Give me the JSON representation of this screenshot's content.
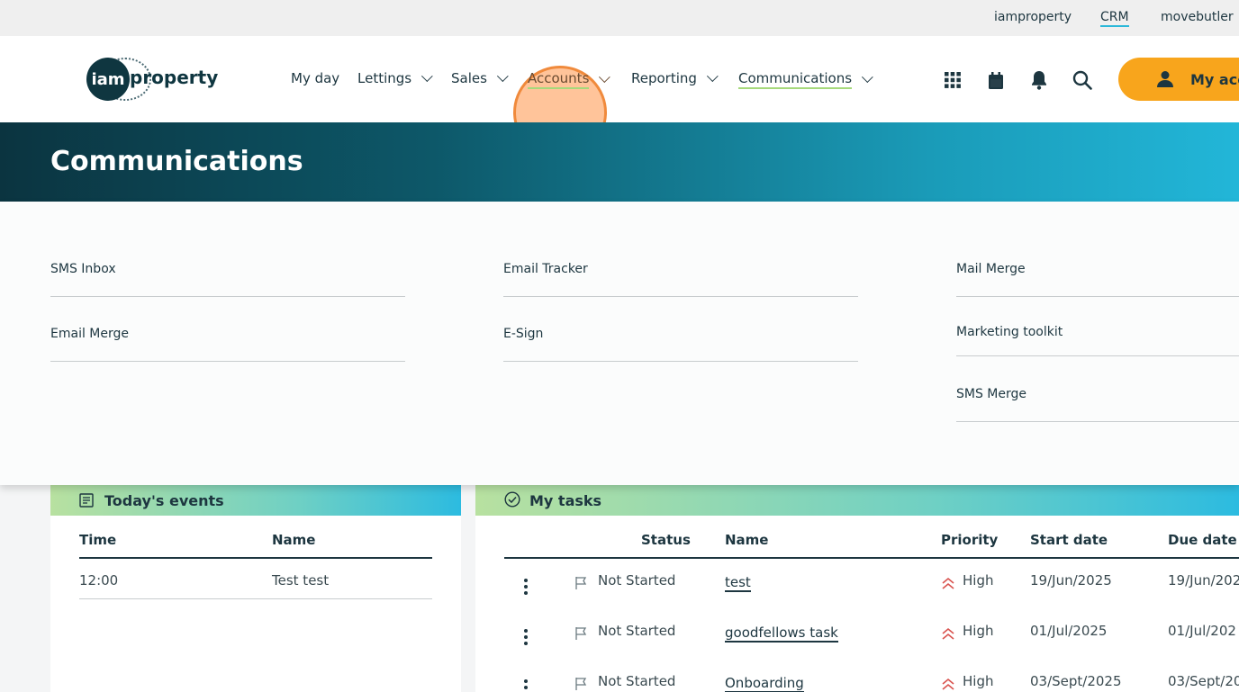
{
  "utility_bar": {
    "links": [
      "iamproperty",
      "CRM",
      "movebutler"
    ]
  },
  "logo": {
    "mark": "iam",
    "word": "property"
  },
  "nav": {
    "items": [
      {
        "label": "My day"
      },
      {
        "label": "Lettings"
      },
      {
        "label": "Sales"
      },
      {
        "label": "Accounts"
      },
      {
        "label": "Reporting"
      },
      {
        "label": "Communications"
      }
    ]
  },
  "header_icons": [
    "apps-grid-icon",
    "calendar-icon",
    "bell-icon",
    "search-icon"
  ],
  "account": {
    "label": "My acc"
  },
  "banner": {
    "title": "Communications"
  },
  "dropdown": {
    "columns": [
      [
        "SMS Inbox",
        "Email Merge"
      ],
      [
        "Email Tracker",
        "E-Sign"
      ],
      [
        "Mail Merge",
        "Marketing toolkit",
        "SMS Merge"
      ]
    ]
  },
  "events": {
    "title": "Today's events",
    "columns": [
      "Time",
      "Name"
    ],
    "rows": [
      [
        "12:00",
        "Test test"
      ]
    ]
  },
  "tasks": {
    "title": "My tasks",
    "columns": [
      "Status",
      "Name",
      "Priority",
      "Start date",
      "Due date"
    ],
    "rows": [
      {
        "status": "Not Started",
        "name": "test",
        "priority": "High",
        "start": "19/Jun/2025",
        "due": "19/Jun/202"
      },
      {
        "status": "Not Started",
        "name": "goodfellows task",
        "priority": "High",
        "start": "01/Jul/2025",
        "due": "01/Jul/202"
      },
      {
        "status": "Not Started",
        "name": "Onboarding",
        "priority": "High",
        "start": "03/Sept/2025",
        "due": "03/Sept/20"
      }
    ]
  },
  "colors": {
    "brand_dark": "#0f3640",
    "accent_orange": "#f8a51c",
    "accent_green": "#a6d97b",
    "accent_cyan": "#2bb8d9",
    "priority_red": "#d9534f"
  }
}
